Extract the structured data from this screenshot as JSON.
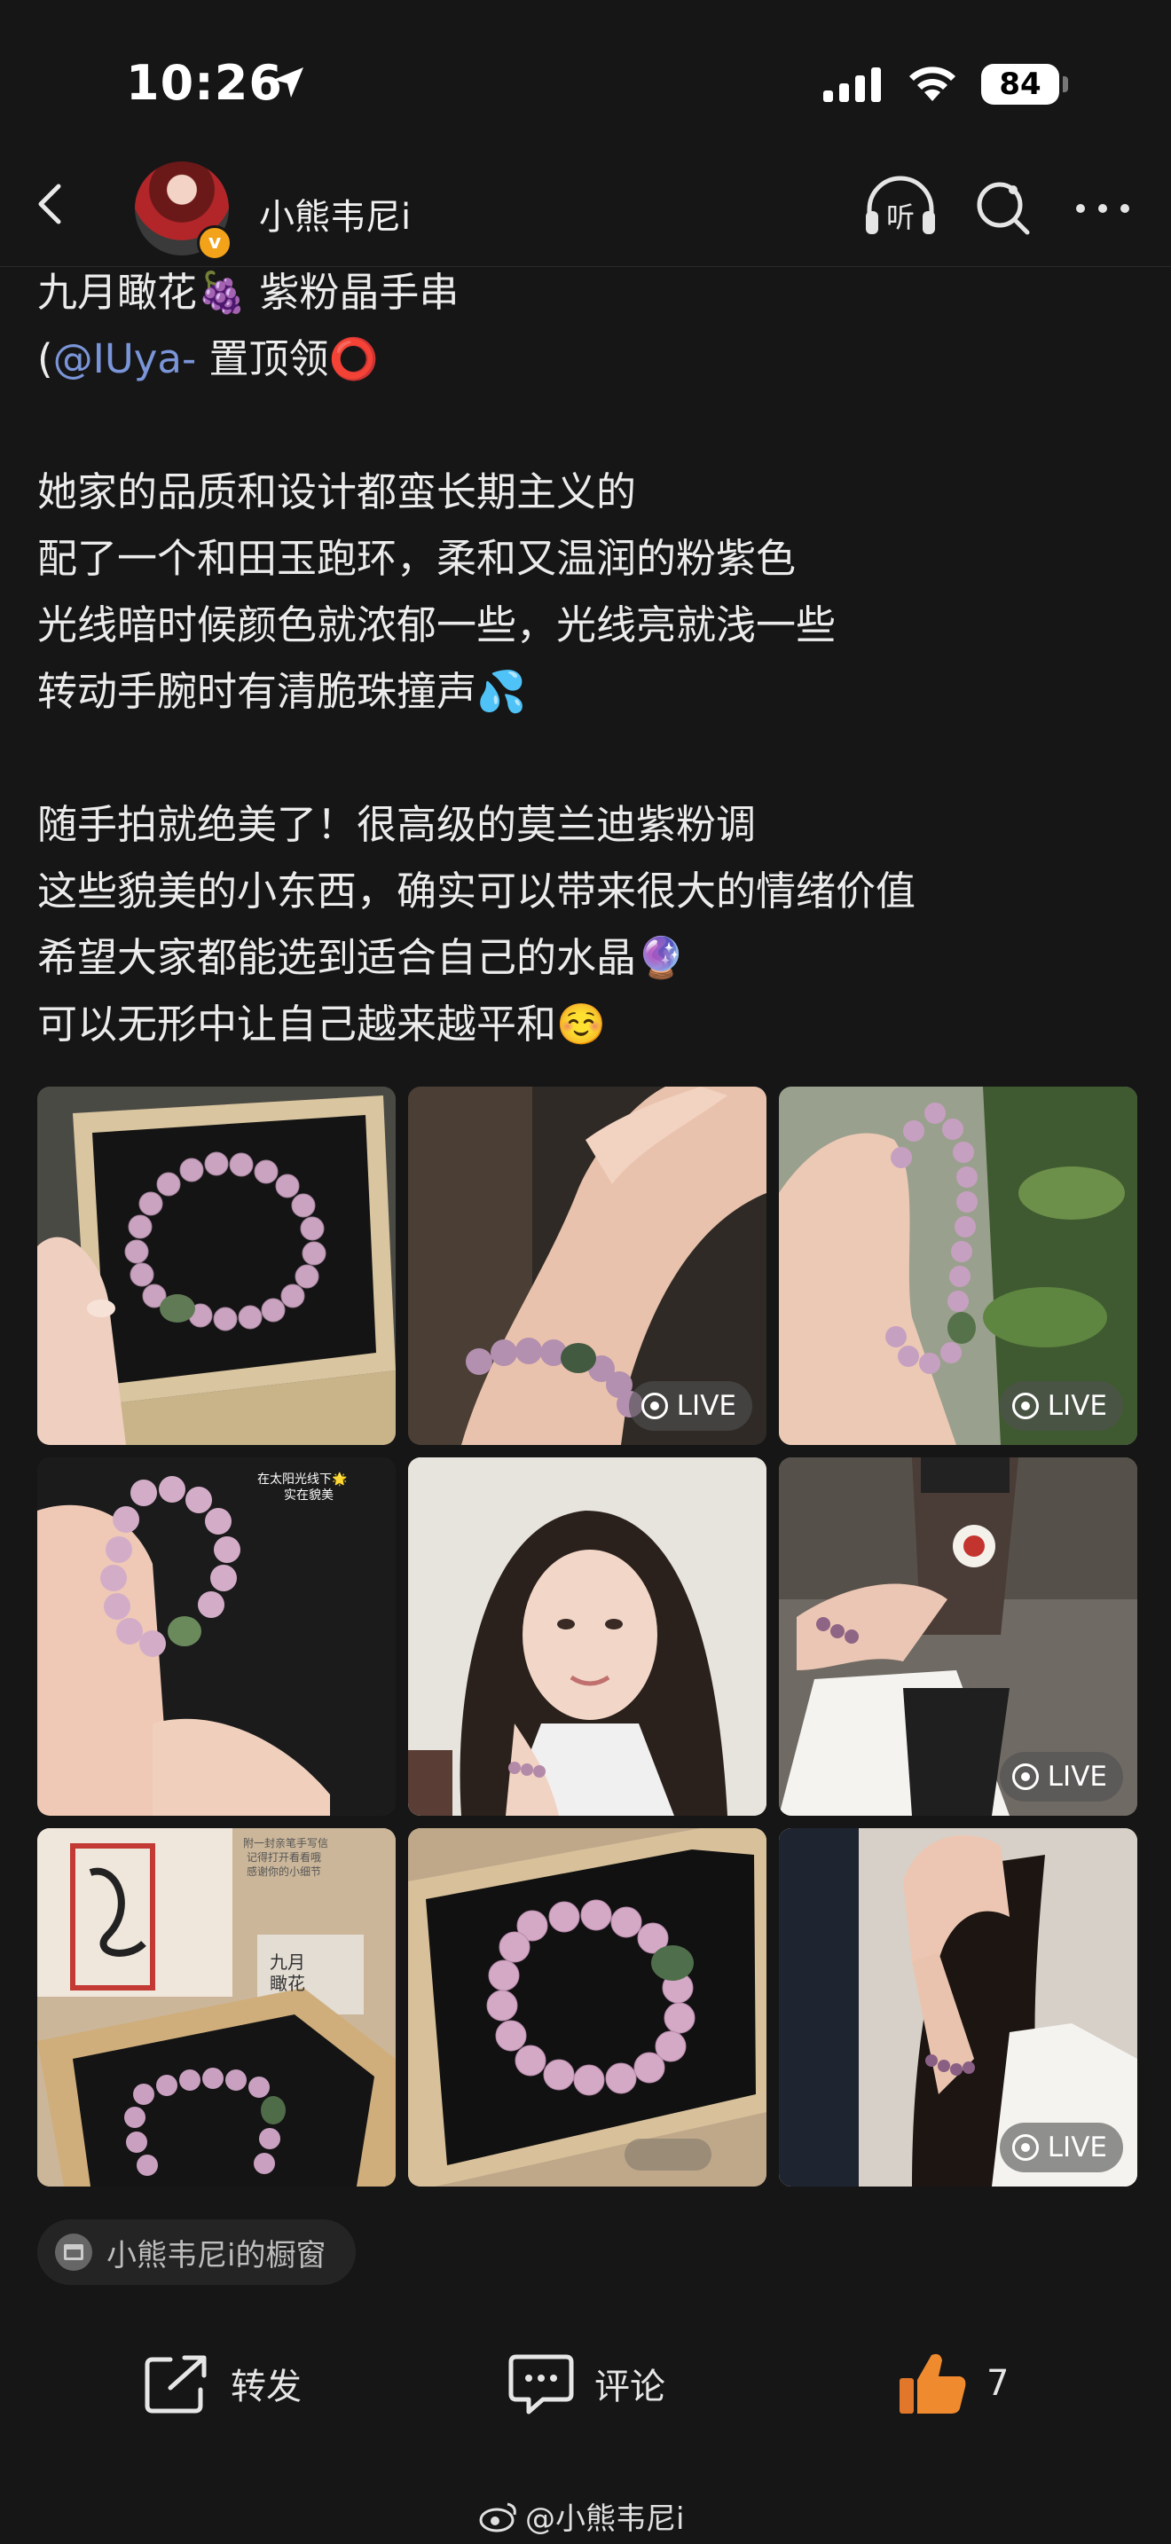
{
  "status_bar": {
    "time": "10:26",
    "battery": "84"
  },
  "header": {
    "user_name": "小熊韦尼i",
    "listen_label": "听"
  },
  "post": {
    "lines": [
      {
        "text": "九月瞰花🍇 紫粉晶手串"
      },
      {
        "pre": "(",
        "mention": "@IUya-",
        "post": " 置顶领⭕"
      },
      {
        "text": ""
      },
      {
        "text": "她家的品质和设计都蛮长期主义的"
      },
      {
        "text": "配了一个和田玉跑环，柔和又温润的粉紫色"
      },
      {
        "text": "光线暗时候颜色就浓郁一些，光线亮就浅一些"
      },
      {
        "text": "转动手腕时有清脆珠撞声💦"
      },
      {
        "text": ""
      },
      {
        "text": "随手拍就绝美了！很高级的莫兰迪紫粉调"
      },
      {
        "text": "这些貌美的小东西，确实可以带来很大的情绪价值"
      },
      {
        "text": "希望大家都能选到适合自己的水晶🔮"
      },
      {
        "text": "可以无形中让自己越来越平和☺️"
      }
    ]
  },
  "images": [
    {
      "name": "photo-bracelet-in-box",
      "live": false
    },
    {
      "name": "photo-bracelet-on-wrist",
      "live": true,
      "live_label": "LIVE"
    },
    {
      "name": "photo-bracelet-held",
      "live": true,
      "live_label": "LIVE"
    },
    {
      "name": "photo-bracelet-sunlight",
      "live": false,
      "caption_1": "在太阳光线下🌟",
      "caption_2": "实在貌美"
    },
    {
      "name": "photo-selfie",
      "live": false
    },
    {
      "name": "photo-cup-and-bracelet",
      "live": true,
      "live_label": "LIVE"
    },
    {
      "name": "photo-packaging",
      "live": false,
      "caption_1": "附一封亲笔手写信",
      "caption_2": "记得打开看看哦",
      "caption_3": "感谢你的小细节",
      "card_1": "九月",
      "card_2": "瞰花"
    },
    {
      "name": "photo-bracelet-black-box",
      "live": false
    },
    {
      "name": "photo-woman-white-shirt",
      "live": true,
      "live_label": "LIVE"
    }
  ],
  "shop": {
    "label": "小熊韦尼i的橱窗"
  },
  "actions": {
    "repost": "转发",
    "comment": "评论",
    "like_count": "7"
  },
  "watermark": {
    "text": "@小熊韦尼i"
  },
  "colors": {
    "background": "#161616",
    "mention": "#7a95d8",
    "like": "#f08a2e"
  }
}
